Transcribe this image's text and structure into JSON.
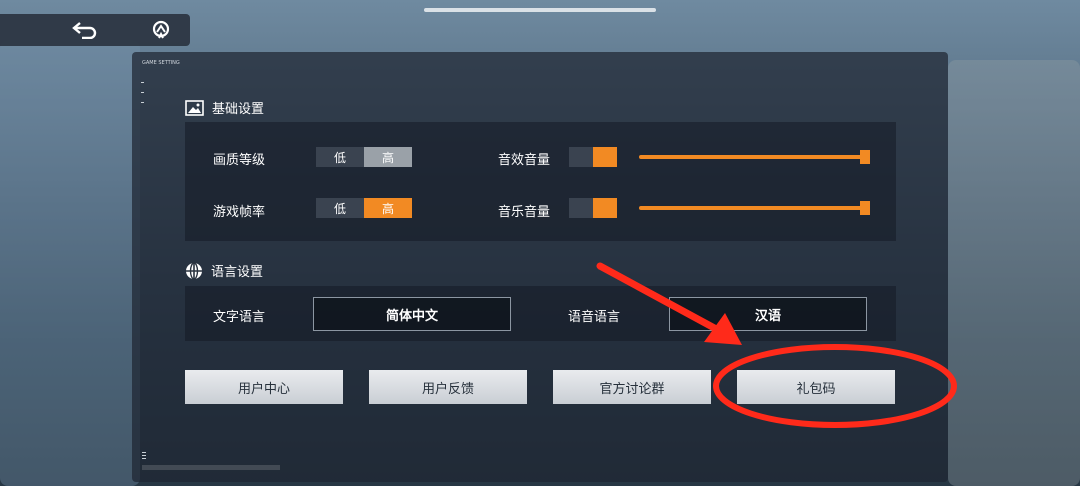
{
  "colors": {
    "accent": "#f28a23",
    "annotation_red": "#ff2a1a"
  },
  "panel": {
    "tag": "GAME SETTING"
  },
  "basic": {
    "title": "基础设置",
    "quality_label": "画质等级",
    "quality_low": "低",
    "quality_high": "高",
    "framerate_label": "游戏帧率",
    "framerate_low": "低",
    "framerate_high": "高",
    "sfx_label": "音效音量",
    "music_label": "音乐音量"
  },
  "language": {
    "title": "语言设置",
    "text_label": "文字语言",
    "text_value": "简体中文",
    "voice_label": "语音语言",
    "voice_value": "汉语"
  },
  "buttons": {
    "user_center": "用户中心",
    "feedback": "用户反馈",
    "official_group": "官方讨论群",
    "gift_code": "礼包码"
  }
}
